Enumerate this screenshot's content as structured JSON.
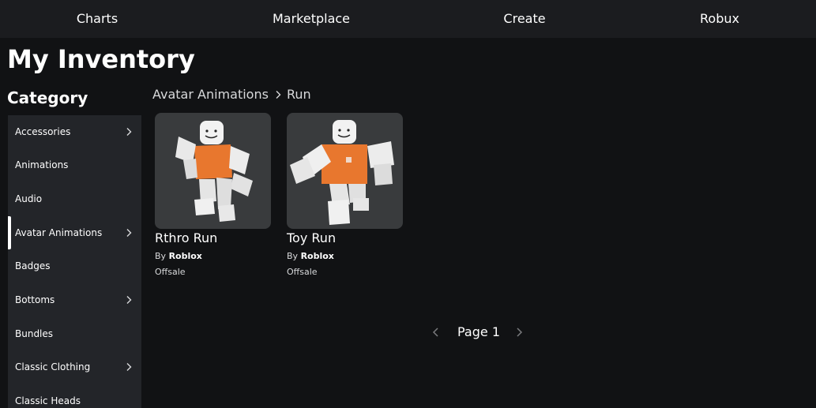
{
  "topnav": {
    "items": [
      {
        "label": "Charts"
      },
      {
        "label": "Marketplace"
      },
      {
        "label": "Create"
      },
      {
        "label": "Robux"
      }
    ]
  },
  "page": {
    "title": "My Inventory"
  },
  "sidebar": {
    "heading": "Category",
    "items": [
      {
        "label": "Accessories",
        "has_submenu": true
      },
      {
        "label": "Animations",
        "has_submenu": false
      },
      {
        "label": "Audio",
        "has_submenu": false
      },
      {
        "label": "Avatar Animations",
        "has_submenu": true,
        "active": true
      },
      {
        "label": "Badges",
        "has_submenu": false
      },
      {
        "label": "Bottoms",
        "has_submenu": true
      },
      {
        "label": "Bundles",
        "has_submenu": false
      },
      {
        "label": "Classic Clothing",
        "has_submenu": true
      },
      {
        "label": "Classic Heads",
        "has_submenu": false
      }
    ]
  },
  "breadcrumb": {
    "parent": "Avatar Animations",
    "current": "Run"
  },
  "items": [
    {
      "name": "Rthro Run",
      "by_prefix": "By",
      "creator": "Roblox",
      "price": "Offsale"
    },
    {
      "name": "Toy Run",
      "by_prefix": "By",
      "creator": "Roblox",
      "price": "Offsale"
    }
  ],
  "pager": {
    "label": "Page 1"
  },
  "colors": {
    "background": "#111214",
    "topnav": "#1b1c1f",
    "sidebar": "#232529",
    "thumb_bg": "#393b3d",
    "avatar_torso": "#e8772e",
    "text": "#ffffff"
  }
}
